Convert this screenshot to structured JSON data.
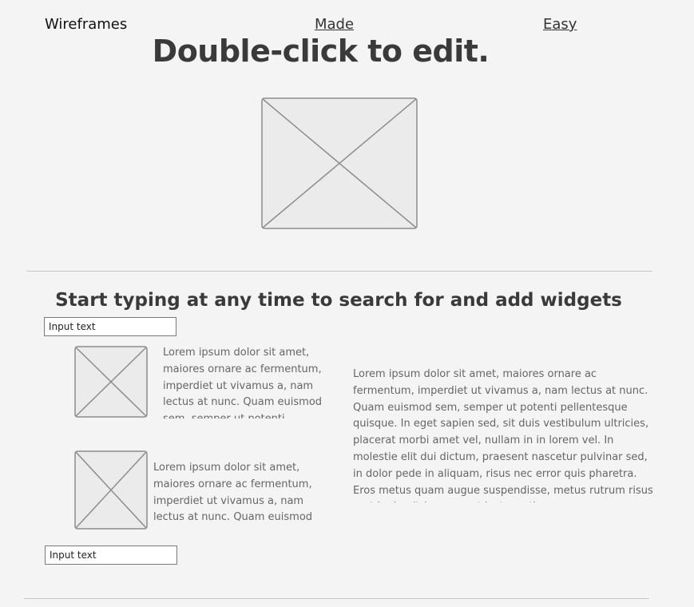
{
  "nav": {
    "brand": "Wireframes",
    "link_made": "Made",
    "link_easy": "Easy"
  },
  "hero": {
    "title": "Double-click to edit."
  },
  "section": {
    "title": "Start typing at any time to search for and add widgets"
  },
  "inputs": {
    "top_value": "Input text",
    "bottom_value": "Input text"
  },
  "text_blocks": {
    "short_1": "Lorem ipsum dolor sit amet, maiores ornare ac fermentum, imperdiet ut vivamus a, nam lectus at nunc. Quam euismod sem, semper ut potenti",
    "short_2": "Lorem ipsum dolor sit amet, maiores ornare ac fermentum, imperdiet ut vivamus a, nam lectus at nunc. Quam euismod",
    "long": "Lorem ipsum dolor sit amet, maiores ornare ac fermentum, imperdiet ut vivamus a, nam lectus at nunc. Quam euismod sem, semper ut potenti pellentesque quisque. In eget sapien sed, sit duis vestibulum ultricies, placerat morbi amet vel, nullam in in lorem vel. In molestie elit dui dictum, praesent nascetur pulvinar sed, in dolor pede in aliquam, risus nec error quis pharetra. Eros metus quam augue suspendisse, metus rutrum risus erat in.  In ultrices quo ut lectus, etiam"
  },
  "colors": {
    "background": "#f4f4f4",
    "placeholder_fill": "#ebebeb",
    "placeholder_stroke": "#8c8c8c",
    "divider": "#c8c8c8"
  },
  "icons": {
    "image_placeholder": "image-placeholder-icon"
  }
}
